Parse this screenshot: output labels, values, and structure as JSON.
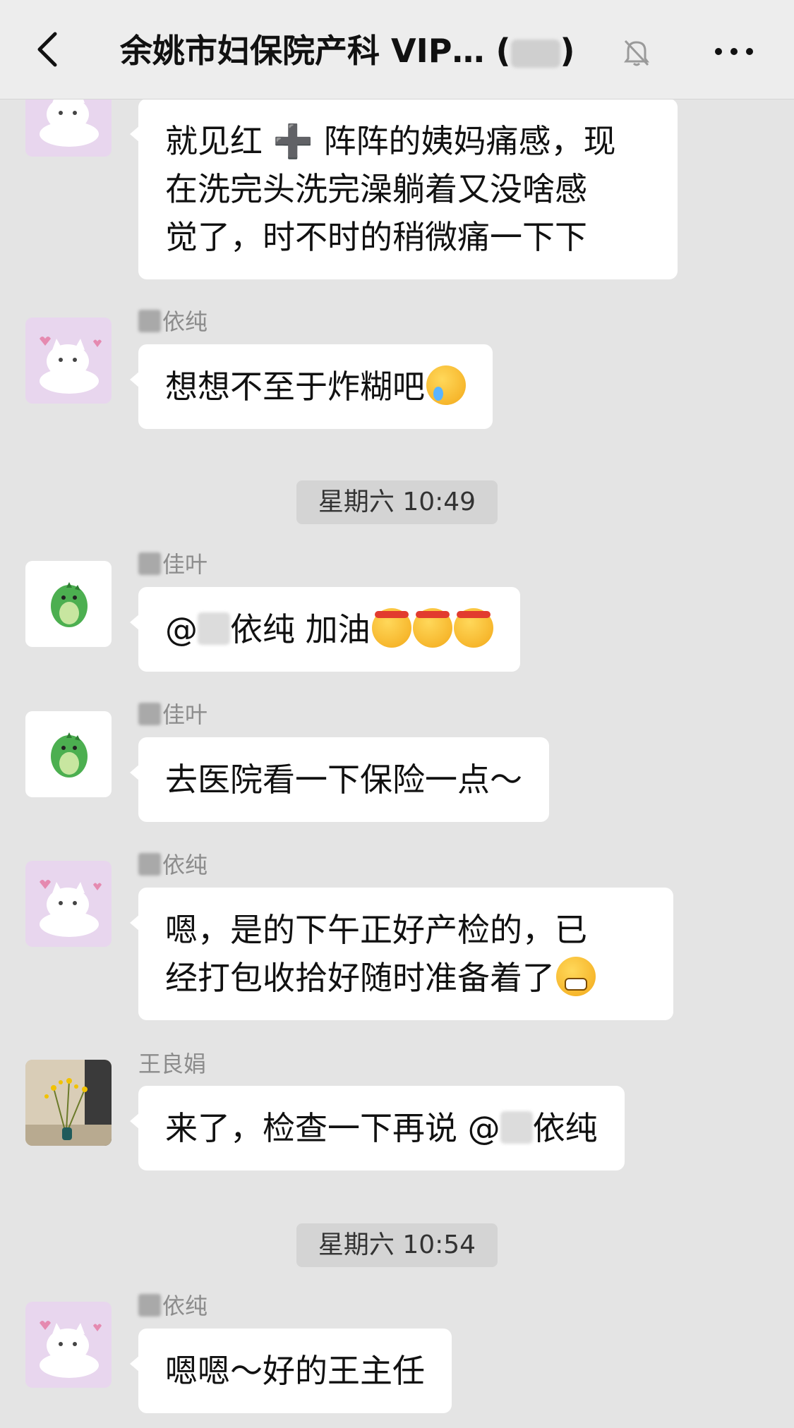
{
  "header": {
    "title": "余姚市妇保院产科 VIP…",
    "member_count_prefix": "(",
    "member_count_suffix": ")"
  },
  "messages": [
    {
      "lines": [
        "就见红 ➕ 阵阵的姨妈痛感，现",
        "在洗完头洗完澡躺着又没啥感",
        "觉了，时不时的稍微痛一下下"
      ]
    },
    {
      "name": "依纯",
      "text": "想想不至于炸糊吧"
    },
    {
      "time": "星期六 10:49"
    },
    {
      "name": "佳叶",
      "text_prefix": "@",
      "text_suffix": "依纯 加油"
    },
    {
      "name": "佳叶",
      "text": "去医院看一下保险一点～"
    },
    {
      "name": "依纯",
      "lines": [
        "嗯，是的下午正好产检的，已",
        "经打包收拾好随时准备着了"
      ]
    },
    {
      "name": "王良娟",
      "text_prefix": "来了，检查一下再说 @",
      "text_suffix": "依纯"
    },
    {
      "time": "星期六 10:54"
    },
    {
      "name": "依纯",
      "text": "嗯嗯～好的王主任"
    }
  ],
  "icons": {
    "back": "chevron-left-icon",
    "mute": "bell-muted-icon",
    "more": "more-dots-icon"
  }
}
